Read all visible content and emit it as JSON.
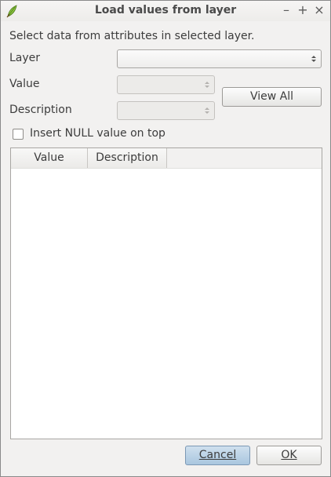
{
  "window": {
    "title": "Load values from layer",
    "app_icon": "qgis-leaf-icon",
    "controls": [
      "minimize",
      "maximize",
      "close"
    ]
  },
  "intro_text": "Select data from attributes in selected layer.",
  "form": {
    "layer_label": "Layer",
    "layer_value": "",
    "value_label": "Value",
    "value_value": "",
    "description_label": "Description",
    "description_value": ""
  },
  "view_all_label": "View All",
  "insert_null": {
    "label": "Insert NULL value on top",
    "checked": false
  },
  "table": {
    "columns": [
      "Value",
      "Description"
    ],
    "rows": []
  },
  "buttons": {
    "cancel_label": "Cancel",
    "ok_label": "OK"
  },
  "colors": {
    "window_bg": "#f2f1f0",
    "default_button": "#a9c6df"
  }
}
